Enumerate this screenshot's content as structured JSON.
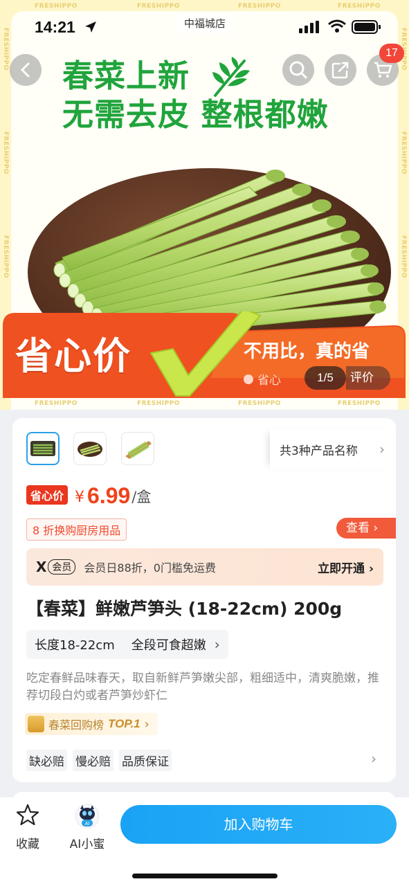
{
  "status_bar": {
    "time": "14:21",
    "store": "中福城店"
  },
  "header": {
    "cart_count": "17"
  },
  "hero": {
    "headline_line1": "春菜上新",
    "headline_line2": "无需去皮 整根都嫩",
    "banner_title": "省心价",
    "banner_slogan": "不用比，真的省",
    "banner_tag": "省心",
    "pager": "1/5",
    "reviews_tab": "评价",
    "watermark": "FRESHIPPO"
  },
  "product": {
    "variants_label": "共3种产品名称",
    "price_badge": "省心价",
    "currency": "¥",
    "price": "6.99",
    "unit": "/盒",
    "promo": "8 折换购厨房用品",
    "view_label": "查看",
    "member_brand": "X",
    "member_tag": "会员",
    "member_text": "会员日88折，0门槛免运费",
    "member_cta": "立即开通",
    "title": "【春菜】鲜嫩芦笋头 (18-22cm) 200g",
    "spec1": "长度18-22cm",
    "spec2": "全段可食超嫩",
    "description": "吃定春鲜品味春天，取自新鲜芦笋嫩尖部，粗细适中，清爽脆嫩，推荐切段白灼或者芦笋炒虾仁",
    "rank_label": "春菜回购榜",
    "rank_top": "TOP.1",
    "guarantees": [
      "缺必赔",
      "慢必赔",
      "品质保证"
    ]
  },
  "bottom_bar": {
    "favorite": "收藏",
    "assistant": "AI小蜜",
    "assistant_badge": "AI",
    "add_to_cart": "加入购物车"
  },
  "colors": {
    "brand_green": "#20a43c",
    "price_red": "#f0421c",
    "cta_blue": "#1aa2f5",
    "banner_orange": "#f05a1e"
  }
}
